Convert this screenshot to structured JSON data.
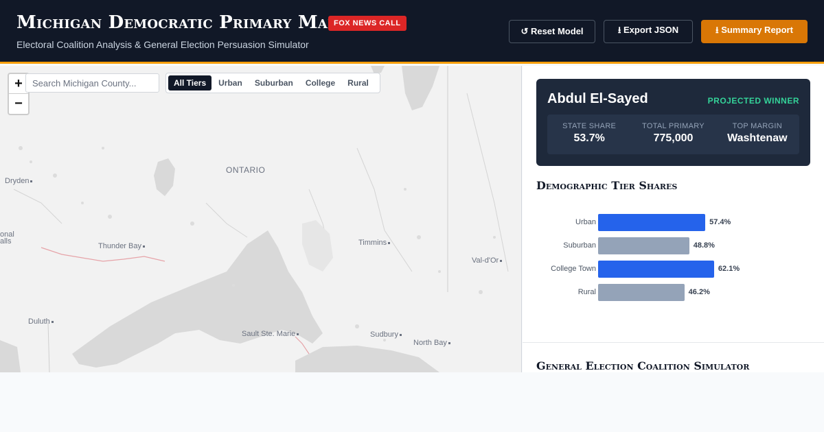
{
  "header": {
    "title": "Michigan Democratic Primary Map",
    "badge": "FOX NEWS CALL",
    "subtitle": "Electoral Coalition Analysis & General Election Persuasion Simulator",
    "buttons": {
      "reset": "↺ Reset Model",
      "export": "⭳ Export JSON",
      "summary": "⭳ Summary Report"
    }
  },
  "map": {
    "zoom_in": "+",
    "zoom_out": "−",
    "search_placeholder": "Search Michigan County...",
    "tiers": [
      "All Tiers",
      "Urban",
      "Suburban",
      "College",
      "Rural"
    ],
    "active_tier": "All Tiers",
    "labels": {
      "ontario": "ONTARIO",
      "dryden": "Dryden",
      "thunder_bay": "Thunder Bay",
      "timmins": "Timmins",
      "val_dor": "Val-d'Or",
      "duluth": "Duluth",
      "sault": "Sault Ste. Marie",
      "sudbury": "Sudbury",
      "north_bay": "North Bay",
      "edge_top": "onal",
      "edge_bottom": "alls"
    }
  },
  "winner_card": {
    "candidate": "Abdul El-Sayed",
    "status": "PROJECTED WINNER",
    "stats": [
      {
        "label": "STATE SHARE",
        "value": "53.7%"
      },
      {
        "label": "TOTAL PRIMARY",
        "value": "775,000"
      },
      {
        "label": "TOP MARGIN",
        "value": "Washtenaw"
      }
    ]
  },
  "demographics": {
    "title": "Demographic Tier Shares"
  },
  "simulator": {
    "title": "General Election Coalition Simulator"
  },
  "colors": {
    "header_bg": "#111827",
    "accent": "#f59e0b",
    "bar_highlight": "#2563eb",
    "bar_muted": "#94a3b8",
    "winner_green": "#34d399",
    "badge_red": "#dc2626"
  },
  "chart_data": {
    "type": "bar",
    "orientation": "horizontal",
    "categories": [
      "Urban",
      "Suburban",
      "College Town",
      "Rural"
    ],
    "values": [
      57.4,
      48.8,
      62.1,
      46.2
    ],
    "value_labels": [
      "57.4%",
      "48.8%",
      "62.1%",
      "46.2%"
    ],
    "highlight": [
      true,
      false,
      true,
      false
    ],
    "xlim": [
      0,
      100
    ]
  }
}
